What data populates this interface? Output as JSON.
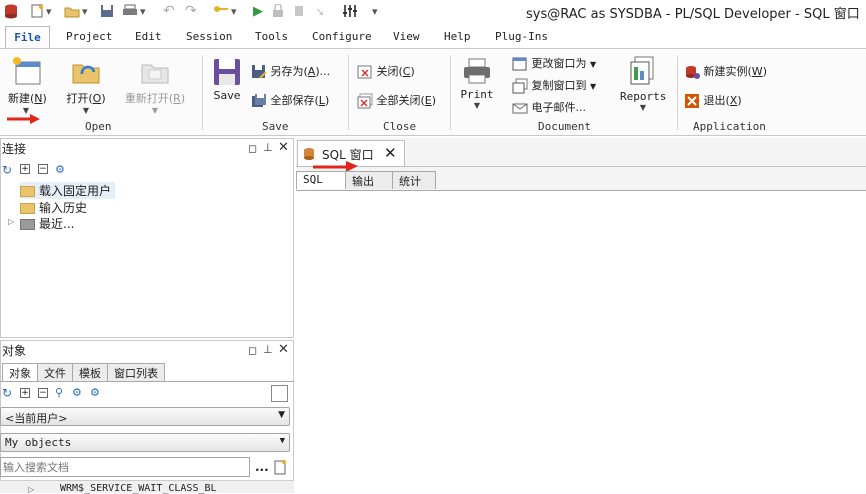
{
  "window": {
    "title": "sys@RAC as SYSDBA - PL/SQL Developer - SQL 窗口"
  },
  "menu": {
    "file": "File",
    "items": [
      "Project",
      "Edit",
      "Session",
      "Tools",
      "Configure",
      "View",
      "Help",
      "Plug-Ins"
    ]
  },
  "ribbon": {
    "open": {
      "new": "新建",
      "new_key": "N",
      "open": "打开",
      "open_key": "O",
      "reopen": "重新打开",
      "reopen_key": "R",
      "label": "Open"
    },
    "save": {
      "save": "Save",
      "save_as": "另存为",
      "save_as_key": "A",
      "save_all": "全部保存",
      "save_all_key": "L",
      "label": "Save"
    },
    "close": {
      "close": "关闭",
      "close_key": "C",
      "close_all": "全部关闭",
      "close_all_key": "E",
      "label": "Close"
    },
    "document": {
      "print": "Print",
      "change_window": "更改窗口为",
      "copy_window": "复制窗口到",
      "email": "电子邮件...",
      "reports": "Reports",
      "label": "Document"
    },
    "application": {
      "new_instance": "新建实例",
      "new_instance_key": "W",
      "exit": "退出",
      "exit_key": "X",
      "label": "Application"
    }
  },
  "connections_panel": {
    "title": "连接",
    "items": [
      "载入固定用户",
      "输入历史",
      "最近..."
    ]
  },
  "objects_panel": {
    "title": "对象",
    "tabs": [
      "对象",
      "文件",
      "模板",
      "窗口列表"
    ],
    "user_combo": "<当前用户>",
    "filter_combo": "My objects",
    "search_placeholder": "输入搜索文档",
    "first_item": "WRM$_SERVICE_WAIT_CLASS_BL"
  },
  "sql_window": {
    "tab_label": "SQL 窗口",
    "subtabs": [
      "SQL",
      "输出",
      "统计"
    ]
  },
  "colors": {
    "accent": "#1a56a6",
    "arrow": "#e0261c"
  }
}
